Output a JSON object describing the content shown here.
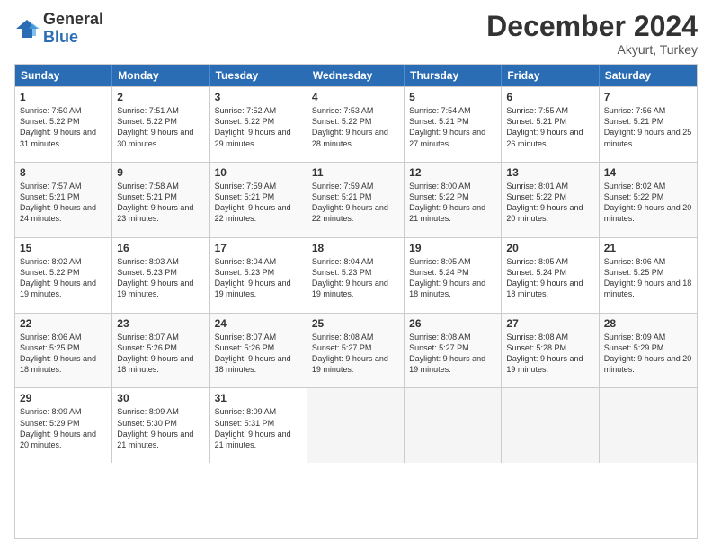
{
  "logo": {
    "general": "General",
    "blue": "Blue"
  },
  "header": {
    "month": "December 2024",
    "location": "Akyurt, Turkey"
  },
  "weekdays": [
    "Sunday",
    "Monday",
    "Tuesday",
    "Wednesday",
    "Thursday",
    "Friday",
    "Saturday"
  ],
  "rows": [
    [
      {
        "day": "1",
        "sunrise": "7:50 AM",
        "sunset": "5:22 PM",
        "daylight": "9 hours and 31 minutes."
      },
      {
        "day": "2",
        "sunrise": "7:51 AM",
        "sunset": "5:22 PM",
        "daylight": "9 hours and 30 minutes."
      },
      {
        "day": "3",
        "sunrise": "7:52 AM",
        "sunset": "5:22 PM",
        "daylight": "9 hours and 29 minutes."
      },
      {
        "day": "4",
        "sunrise": "7:53 AM",
        "sunset": "5:22 PM",
        "daylight": "9 hours and 28 minutes."
      },
      {
        "day": "5",
        "sunrise": "7:54 AM",
        "sunset": "5:21 PM",
        "daylight": "9 hours and 27 minutes."
      },
      {
        "day": "6",
        "sunrise": "7:55 AM",
        "sunset": "5:21 PM",
        "daylight": "9 hours and 26 minutes."
      },
      {
        "day": "7",
        "sunrise": "7:56 AM",
        "sunset": "5:21 PM",
        "daylight": "9 hours and 25 minutes."
      }
    ],
    [
      {
        "day": "8",
        "sunrise": "7:57 AM",
        "sunset": "5:21 PM",
        "daylight": "9 hours and 24 minutes."
      },
      {
        "day": "9",
        "sunrise": "7:58 AM",
        "sunset": "5:21 PM",
        "daylight": "9 hours and 23 minutes."
      },
      {
        "day": "10",
        "sunrise": "7:59 AM",
        "sunset": "5:21 PM",
        "daylight": "9 hours and 22 minutes."
      },
      {
        "day": "11",
        "sunrise": "7:59 AM",
        "sunset": "5:21 PM",
        "daylight": "9 hours and 22 minutes."
      },
      {
        "day": "12",
        "sunrise": "8:00 AM",
        "sunset": "5:22 PM",
        "daylight": "9 hours and 21 minutes."
      },
      {
        "day": "13",
        "sunrise": "8:01 AM",
        "sunset": "5:22 PM",
        "daylight": "9 hours and 20 minutes."
      },
      {
        "day": "14",
        "sunrise": "8:02 AM",
        "sunset": "5:22 PM",
        "daylight": "9 hours and 20 minutes."
      }
    ],
    [
      {
        "day": "15",
        "sunrise": "8:02 AM",
        "sunset": "5:22 PM",
        "daylight": "9 hours and 19 minutes."
      },
      {
        "day": "16",
        "sunrise": "8:03 AM",
        "sunset": "5:23 PM",
        "daylight": "9 hours and 19 minutes."
      },
      {
        "day": "17",
        "sunrise": "8:04 AM",
        "sunset": "5:23 PM",
        "daylight": "9 hours and 19 minutes."
      },
      {
        "day": "18",
        "sunrise": "8:04 AM",
        "sunset": "5:23 PM",
        "daylight": "9 hours and 19 minutes."
      },
      {
        "day": "19",
        "sunrise": "8:05 AM",
        "sunset": "5:24 PM",
        "daylight": "9 hours and 18 minutes."
      },
      {
        "day": "20",
        "sunrise": "8:05 AM",
        "sunset": "5:24 PM",
        "daylight": "9 hours and 18 minutes."
      },
      {
        "day": "21",
        "sunrise": "8:06 AM",
        "sunset": "5:25 PM",
        "daylight": "9 hours and 18 minutes."
      }
    ],
    [
      {
        "day": "22",
        "sunrise": "8:06 AM",
        "sunset": "5:25 PM",
        "daylight": "9 hours and 18 minutes."
      },
      {
        "day": "23",
        "sunrise": "8:07 AM",
        "sunset": "5:26 PM",
        "daylight": "9 hours and 18 minutes."
      },
      {
        "day": "24",
        "sunrise": "8:07 AM",
        "sunset": "5:26 PM",
        "daylight": "9 hours and 18 minutes."
      },
      {
        "day": "25",
        "sunrise": "8:08 AM",
        "sunset": "5:27 PM",
        "daylight": "9 hours and 19 minutes."
      },
      {
        "day": "26",
        "sunrise": "8:08 AM",
        "sunset": "5:27 PM",
        "daylight": "9 hours and 19 minutes."
      },
      {
        "day": "27",
        "sunrise": "8:08 AM",
        "sunset": "5:28 PM",
        "daylight": "9 hours and 19 minutes."
      },
      {
        "day": "28",
        "sunrise": "8:09 AM",
        "sunset": "5:29 PM",
        "daylight": "9 hours and 20 minutes."
      }
    ],
    [
      {
        "day": "29",
        "sunrise": "8:09 AM",
        "sunset": "5:29 PM",
        "daylight": "9 hours and 20 minutes."
      },
      {
        "day": "30",
        "sunrise": "8:09 AM",
        "sunset": "5:30 PM",
        "daylight": "9 hours and 21 minutes."
      },
      {
        "day": "31",
        "sunrise": "8:09 AM",
        "sunset": "5:31 PM",
        "daylight": "9 hours and 21 minutes."
      },
      null,
      null,
      null,
      null
    ]
  ]
}
